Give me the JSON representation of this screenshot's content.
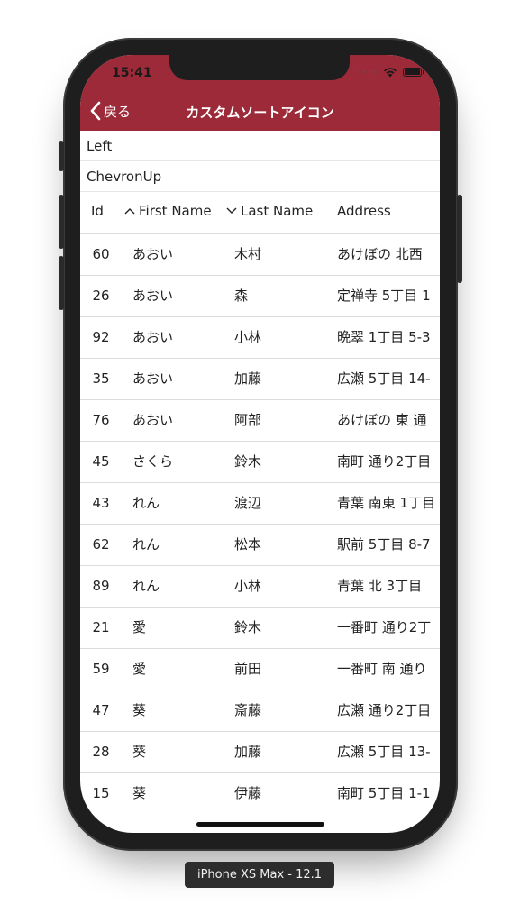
{
  "device_caption": "iPhone XS Max - 12.1",
  "status_bar": {
    "time": "15:41"
  },
  "nav": {
    "back_label": "戻る",
    "title": "カスタムソートアイコン"
  },
  "options": [
    "Left",
    "ChevronUp"
  ],
  "columns": [
    {
      "label": "Id",
      "sort": "none"
    },
    {
      "label": "First Name",
      "sort": "ascending"
    },
    {
      "label": "Last Name",
      "sort": "descending"
    },
    {
      "label": "Address",
      "sort": "none"
    }
  ],
  "rows": [
    {
      "id": "60",
      "first": "あおい",
      "last": "木村",
      "address": "あけぼの 北西"
    },
    {
      "id": "26",
      "first": "あおい",
      "last": "森",
      "address": "定禅寺 5丁目 1"
    },
    {
      "id": "92",
      "first": "あおい",
      "last": "小林",
      "address": "晩翠 1丁目 5-3"
    },
    {
      "id": "35",
      "first": "あおい",
      "last": "加藤",
      "address": "広瀬 5丁目 14-"
    },
    {
      "id": "76",
      "first": "あおい",
      "last": "阿部",
      "address": "あけぼの 東 通"
    },
    {
      "id": "45",
      "first": "さくら",
      "last": "鈴木",
      "address": "南町 通り2丁目"
    },
    {
      "id": "43",
      "first": "れん",
      "last": "渡辺",
      "address": "青葉 南東 1丁目"
    },
    {
      "id": "62",
      "first": "れん",
      "last": "松本",
      "address": "駅前 5丁目 8-7"
    },
    {
      "id": "89",
      "first": "れん",
      "last": "小林",
      "address": "青葉 北 3丁目"
    },
    {
      "id": "21",
      "first": "愛",
      "last": "鈴木",
      "address": "一番町 通り2丁"
    },
    {
      "id": "59",
      "first": "愛",
      "last": "前田",
      "address": "一番町 南 通り"
    },
    {
      "id": "47",
      "first": "葵",
      "last": "斎藤",
      "address": "広瀬 通り2丁目"
    },
    {
      "id": "28",
      "first": "葵",
      "last": "加藤",
      "address": "広瀬 5丁目 13-"
    },
    {
      "id": "15",
      "first": "葵",
      "last": "伊藤",
      "address": "南町 5丁目 1-1"
    }
  ],
  "colors": {
    "nav_bar": "#9c2a39",
    "nav_text": "#ffffff",
    "grid_line": "#dcdcdc"
  },
  "icons": {
    "back": "chevron-left-icon",
    "asc": "chevron-up-icon",
    "desc": "chevron-down-icon",
    "wifi": "wifi-icon",
    "battery": "battery-icon"
  }
}
